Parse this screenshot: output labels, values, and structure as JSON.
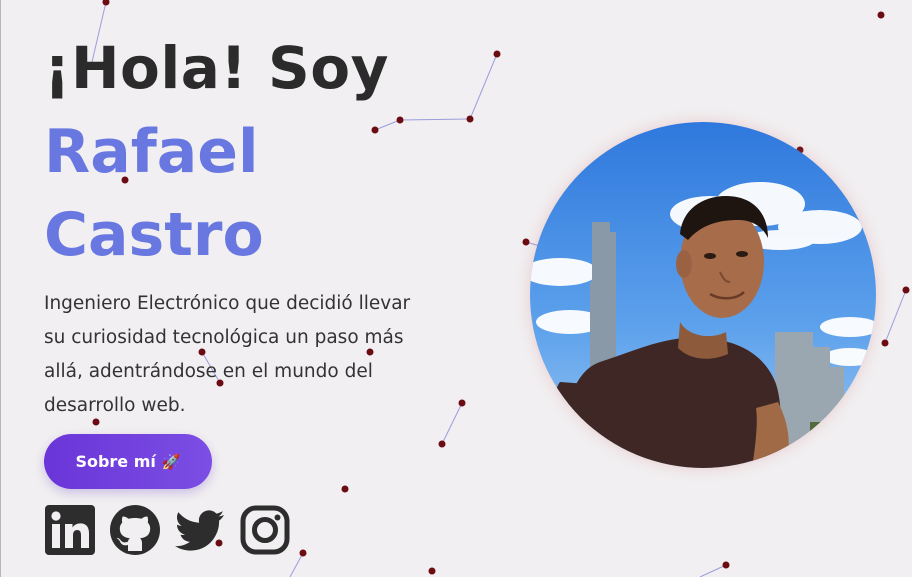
{
  "hero": {
    "greeting": "¡Hola! Soy",
    "first_name": "Rafael",
    "last_name": "Castro",
    "bio": "Ingeniero Electrónico que decidió llevar su curiosidad tecnológica un paso más allá, adentrándose en el mundo del desarrollo web.",
    "button_label": "Sobre mí",
    "button_icon": "rocket-icon",
    "name_color": "#6878e0",
    "button_color": "#6a35d8"
  },
  "socials": [
    {
      "name": "linkedin",
      "icon": "linkedin-icon"
    },
    {
      "name": "github",
      "icon": "github-icon"
    },
    {
      "name": "twitter",
      "icon": "twitter-icon"
    },
    {
      "name": "instagram",
      "icon": "instagram-icon"
    }
  ],
  "profile_photo": {
    "icon": "profile-photo"
  },
  "background": {
    "particle_color": "#6b0b12",
    "link_color": "#8e8ed8"
  }
}
